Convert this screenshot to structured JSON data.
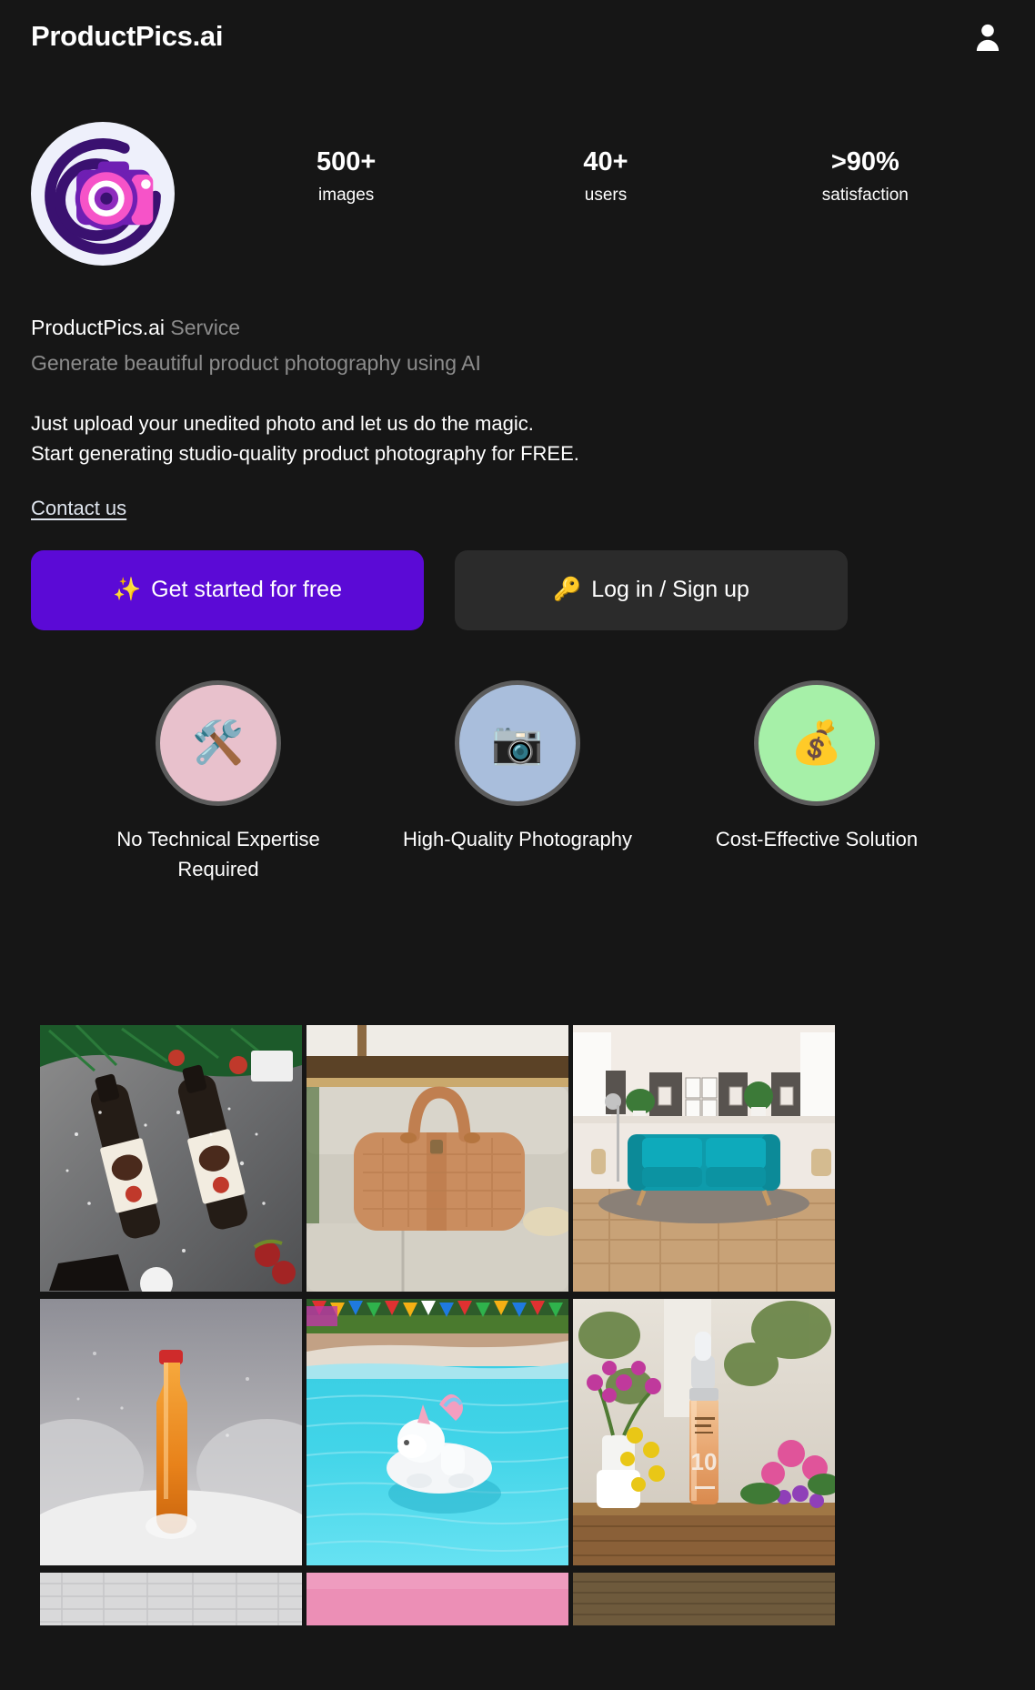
{
  "header": {
    "brand": "ProductPics.ai",
    "account_icon": "person-icon"
  },
  "hero": {
    "logo_icon": "camera-logo-icon",
    "stats": [
      {
        "value": "500+",
        "label": "images"
      },
      {
        "value": "40+",
        "label": "users"
      },
      {
        "value": ">90%",
        "label": "satisfaction"
      }
    ],
    "title_name": "ProductPics.ai",
    "title_suffix": " Service",
    "subtitle": "Generate beautiful product photography using AI",
    "blurb_line1": "Just upload your unedited photo and let us do the magic.",
    "blurb_line2": "Start generating studio-quality product photography for FREE.",
    "contact_link": "Contact us"
  },
  "cta": {
    "primary_emoji": "✨",
    "primary_label": "Get started for free",
    "primary_color": "#5b0ad6",
    "secondary_emoji": "🔑",
    "secondary_label": "Log in / Sign up",
    "secondary_color": "#2b2b2b"
  },
  "features": [
    {
      "emoji": "🛠️",
      "icon": "tools-icon",
      "bg": "#e8c1cc",
      "label": "No Technical Expertise Required"
    },
    {
      "emoji": "📷",
      "icon": "camera-icon",
      "bg": "#a9bedc",
      "label": "High-Quality Photography"
    },
    {
      "emoji": "💰",
      "icon": "money-bag-icon",
      "bg": "#a6f0a8",
      "label": "Cost-Effective Solution"
    }
  ],
  "gallery": {
    "tiles": [
      {
        "name": "wine-bottles-christmas",
        "alt": "Two dark wine bottles with illustrated labels on grey stone with pine branches and red berries"
      },
      {
        "name": "leather-duffel-bag",
        "alt": "Tan crocodile-textured leather duffel bag on a light grey sofa"
      },
      {
        "name": "teal-sofa-living-room",
        "alt": "Teal three-seat sofa in a bright panelled living room with wooden floor"
      },
      {
        "name": "orange-bottle-snow",
        "alt": "Amber glass bottle standing in snow against a grey misty background"
      },
      {
        "name": "unicorn-pool-float",
        "alt": "White unicorn inflatable float on a turquoise swimming pool with party bunting"
      },
      {
        "name": "serum-bottle-flowers",
        "alt": "Amber serum dropper bottle labelled 10 on wood with pink and yellow flowers"
      },
      {
        "name": "partial-tile-grey",
        "alt": "Partially visible light grey fabric texture tile"
      },
      {
        "name": "partial-tile-pink",
        "alt": "Partially visible solid pink tile"
      },
      {
        "name": "partial-tile-wood",
        "alt": "Partially visible brown wood grain tile"
      }
    ]
  }
}
